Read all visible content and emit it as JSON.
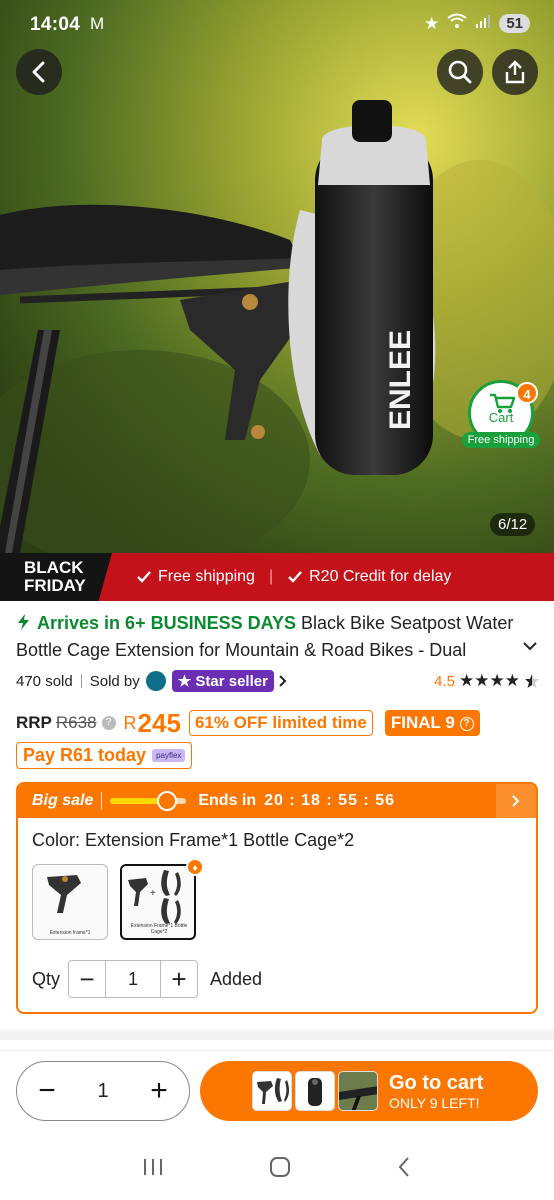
{
  "status_bar": {
    "time": "14:04",
    "mail_icon": "mail-icon",
    "battery": "51"
  },
  "gallery": {
    "counter": "6/12"
  },
  "cart_float": {
    "label": "Cart",
    "count": "4",
    "shipping": "Free shipping"
  },
  "promo_bar": {
    "logo_line1": "BLACK",
    "logo_line2": "FRIDAY",
    "items": [
      "Free shipping",
      "R20 Credit for delay"
    ]
  },
  "product": {
    "arrival": "Arrives in 6+ BUSINESS DAYS",
    "title": " Black Bike Seatpost Water Bottle Cage Extension for Mountain & Road Bikes - Dual Bottle",
    "sold": "470 sold",
    "sold_by": "Sold by",
    "star_seller": "★ Star seller",
    "rating": "4.5",
    "stars": "★★★★",
    "rating_value": 4.5
  },
  "pricing": {
    "rrp_label": "RRP",
    "rrp_value": "R638",
    "currency": "R",
    "price": "245",
    "discount": "61% OFF limited time",
    "final": "FINAL 9",
    "pay_today": "Pay R61 today",
    "payflex": "payflex"
  },
  "sale": {
    "label": "Big sale",
    "ends": "Ends in",
    "countdown": "20 : 18 : 55 : 56",
    "progress": 0.75
  },
  "variant": {
    "color_title": "Color: Extension Frame*1 Bottle Cage*2",
    "swatch1_caption": "Extension frame*1",
    "swatch2_caption": "Extension Frame*1 Bottle Cage*2"
  },
  "quantity": {
    "label": "Qty",
    "value": "1",
    "status": "Added"
  },
  "bottom": {
    "qty": "1",
    "cta": "Go to cart",
    "cta_sub": "ONLY 9 LEFT!"
  },
  "colors": {
    "accent": "#fb7701",
    "green": "#19a03c",
    "promo_red": "#c4121b",
    "star_purple": "#6b2fb5"
  }
}
